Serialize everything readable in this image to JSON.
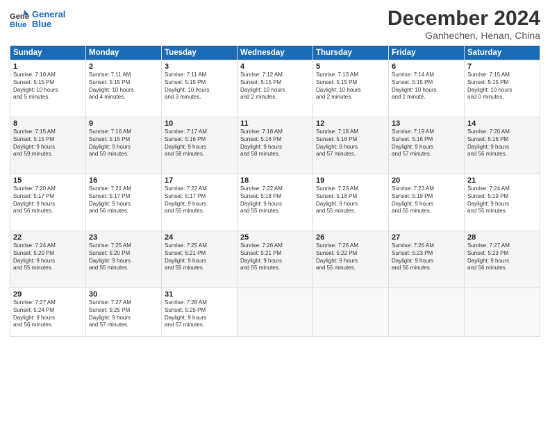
{
  "logo": {
    "line1": "General",
    "line2": "Blue"
  },
  "title": "December 2024",
  "location": "Ganhechen, Henan, China",
  "headers": [
    "Sunday",
    "Monday",
    "Tuesday",
    "Wednesday",
    "Thursday",
    "Friday",
    "Saturday"
  ],
  "weeks": [
    [
      {
        "day": "1",
        "info": "Sunrise: 7:10 AM\nSunset: 5:15 PM\nDaylight: 10 hours\nand 5 minutes."
      },
      {
        "day": "2",
        "info": "Sunrise: 7:11 AM\nSunset: 5:15 PM\nDaylight: 10 hours\nand 4 minutes."
      },
      {
        "day": "3",
        "info": "Sunrise: 7:11 AM\nSunset: 5:15 PM\nDaylight: 10 hours\nand 3 minutes."
      },
      {
        "day": "4",
        "info": "Sunrise: 7:12 AM\nSunset: 5:15 PM\nDaylight: 10 hours\nand 2 minutes."
      },
      {
        "day": "5",
        "info": "Sunrise: 7:13 AM\nSunset: 5:15 PM\nDaylight: 10 hours\nand 2 minutes."
      },
      {
        "day": "6",
        "info": "Sunrise: 7:14 AM\nSunset: 5:15 PM\nDaylight: 10 hours\nand 1 minute."
      },
      {
        "day": "7",
        "info": "Sunrise: 7:15 AM\nSunset: 5:15 PM\nDaylight: 10 hours\nand 0 minutes."
      }
    ],
    [
      {
        "day": "8",
        "info": "Sunrise: 7:15 AM\nSunset: 5:15 PM\nDaylight: 9 hours\nand 59 minutes."
      },
      {
        "day": "9",
        "info": "Sunrise: 7:16 AM\nSunset: 5:15 PM\nDaylight: 9 hours\nand 59 minutes."
      },
      {
        "day": "10",
        "info": "Sunrise: 7:17 AM\nSunset: 5:16 PM\nDaylight: 9 hours\nand 58 minutes."
      },
      {
        "day": "11",
        "info": "Sunrise: 7:18 AM\nSunset: 5:16 PM\nDaylight: 9 hours\nand 58 minutes."
      },
      {
        "day": "12",
        "info": "Sunrise: 7:18 AM\nSunset: 5:16 PM\nDaylight: 9 hours\nand 57 minutes."
      },
      {
        "day": "13",
        "info": "Sunrise: 7:19 AM\nSunset: 5:16 PM\nDaylight: 9 hours\nand 57 minutes."
      },
      {
        "day": "14",
        "info": "Sunrise: 7:20 AM\nSunset: 5:16 PM\nDaylight: 9 hours\nand 56 minutes."
      }
    ],
    [
      {
        "day": "15",
        "info": "Sunrise: 7:20 AM\nSunset: 5:17 PM\nDaylight: 9 hours\nand 56 minutes."
      },
      {
        "day": "16",
        "info": "Sunrise: 7:21 AM\nSunset: 5:17 PM\nDaylight: 9 hours\nand 56 minutes."
      },
      {
        "day": "17",
        "info": "Sunrise: 7:22 AM\nSunset: 5:17 PM\nDaylight: 9 hours\nand 55 minutes."
      },
      {
        "day": "18",
        "info": "Sunrise: 7:22 AM\nSunset: 5:18 PM\nDaylight: 9 hours\nand 55 minutes."
      },
      {
        "day": "19",
        "info": "Sunrise: 7:23 AM\nSunset: 5:18 PM\nDaylight: 9 hours\nand 55 minutes."
      },
      {
        "day": "20",
        "info": "Sunrise: 7:23 AM\nSunset: 5:19 PM\nDaylight: 9 hours\nand 55 minutes."
      },
      {
        "day": "21",
        "info": "Sunrise: 7:24 AM\nSunset: 5:19 PM\nDaylight: 9 hours\nand 55 minutes."
      }
    ],
    [
      {
        "day": "22",
        "info": "Sunrise: 7:24 AM\nSunset: 5:20 PM\nDaylight: 9 hours\nand 55 minutes."
      },
      {
        "day": "23",
        "info": "Sunrise: 7:25 AM\nSunset: 5:20 PM\nDaylight: 9 hours\nand 55 minutes."
      },
      {
        "day": "24",
        "info": "Sunrise: 7:25 AM\nSunset: 5:21 PM\nDaylight: 9 hours\nand 55 minutes."
      },
      {
        "day": "25",
        "info": "Sunrise: 7:26 AM\nSunset: 5:21 PM\nDaylight: 9 hours\nand 55 minutes."
      },
      {
        "day": "26",
        "info": "Sunrise: 7:26 AM\nSunset: 5:22 PM\nDaylight: 9 hours\nand 55 minutes."
      },
      {
        "day": "27",
        "info": "Sunrise: 7:26 AM\nSunset: 5:23 PM\nDaylight: 9 hours\nand 56 minutes."
      },
      {
        "day": "28",
        "info": "Sunrise: 7:27 AM\nSunset: 5:23 PM\nDaylight: 9 hours\nand 56 minutes."
      }
    ],
    [
      {
        "day": "29",
        "info": "Sunrise: 7:27 AM\nSunset: 5:24 PM\nDaylight: 9 hours\nand 56 minutes."
      },
      {
        "day": "30",
        "info": "Sunrise: 7:27 AM\nSunset: 5:25 PM\nDaylight: 9 hours\nand 57 minutes."
      },
      {
        "day": "31",
        "info": "Sunrise: 7:28 AM\nSunset: 5:25 PM\nDaylight: 9 hours\nand 57 minutes."
      },
      {
        "day": "",
        "info": ""
      },
      {
        "day": "",
        "info": ""
      },
      {
        "day": "",
        "info": ""
      },
      {
        "day": "",
        "info": ""
      }
    ]
  ]
}
